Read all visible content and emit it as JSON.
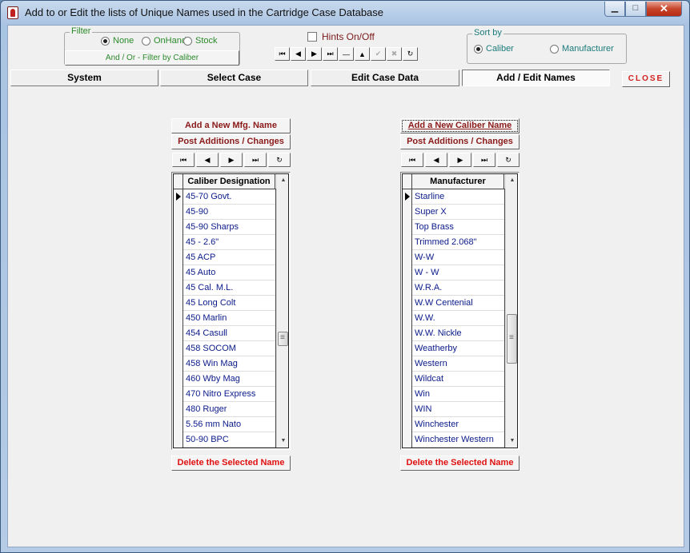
{
  "window": {
    "title": "Add to or Edit the lists of Unique Names used in the Cartridge Case Database",
    "min": "▁",
    "max": "□",
    "close": "✕"
  },
  "filter": {
    "legend": "Filter",
    "options": [
      "None",
      "OnHand",
      "Stock"
    ],
    "selected": "None",
    "caption": "And / Or - Filter by Caliber"
  },
  "hints": {
    "label": "Hints On/Off",
    "checked": false
  },
  "nav_main": [
    "⏮",
    "◀",
    "▶",
    "⏭",
    "—",
    "▲",
    "✔",
    "✖",
    "↻"
  ],
  "sort_by": {
    "legend": "Sort by",
    "options": [
      "Caliber",
      "Manufacturer"
    ],
    "selected": "Caliber"
  },
  "tabs": [
    {
      "label": "System",
      "active": false
    },
    {
      "label": "Select Case",
      "active": false
    },
    {
      "label": "Edit Case Data",
      "active": false
    },
    {
      "label": "Add / Edit Names",
      "active": true
    }
  ],
  "close_label": "CLOSE",
  "left_panel": {
    "add_label": "Add a New Mfg. Name",
    "post_label": "Post Additions / Changes",
    "nav": [
      "⏮",
      "◀",
      "▶",
      "⏭",
      "↻"
    ],
    "header": "Caliber Designation",
    "rows": [
      "45-70 Govt.",
      "45-90",
      "45-90 Sharps",
      "45 - 2.6\"",
      "45 ACP",
      "45 Auto",
      "45 Cal. M.L.",
      "45 Long Colt",
      "450 Marlin",
      "454 Casull",
      "458 SOCOM",
      "458 Win Mag",
      "460 Wby Mag",
      "470 Nitro Express",
      "480 Ruger",
      "5.56 mm Nato",
      "50-90 BPC"
    ],
    "current_row": 0,
    "scroll_fraction": 0.62,
    "delete_label": "Delete the Selected Name"
  },
  "right_panel": {
    "add_label": "Add a New Caliber Name",
    "post_label": "Post Additions / Changes",
    "nav": [
      "⏮",
      "◀",
      "▶",
      "⏭",
      "↻"
    ],
    "header": "Manufacturer",
    "rows": [
      "Starline",
      "Super X",
      "Top Brass",
      "Trimmed 2.068\"",
      "W-W",
      "W  -  W",
      "W.R.A.",
      "W.W Centenial",
      "W.W.",
      "W.W. Nickle",
      "Weatherby",
      "Western",
      "Wildcat",
      "Win",
      "WIN",
      "Winchester",
      "Winchester Western"
    ],
    "current_row": 0,
    "scroll_fraction": 0.64,
    "delete_label": "Delete the Selected Name"
  }
}
